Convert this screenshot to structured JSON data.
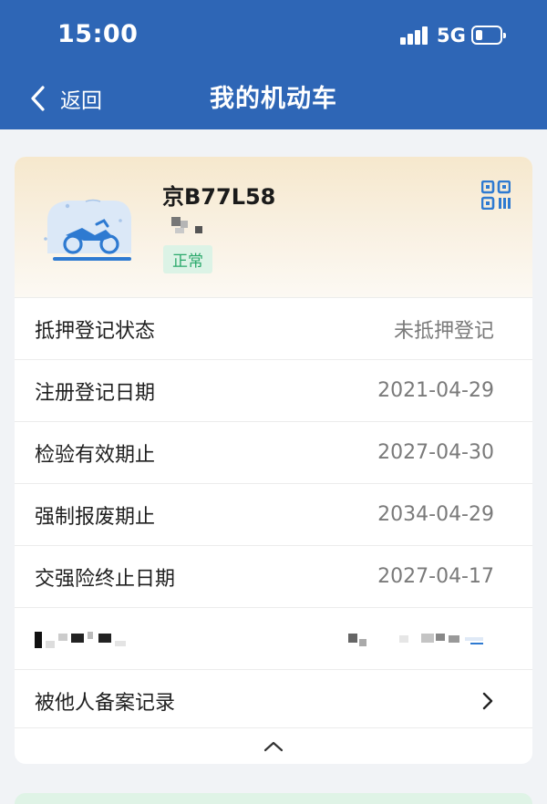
{
  "status_bar": {
    "time": "15:00",
    "network": "5G"
  },
  "nav": {
    "back_label": "返回",
    "title": "我的机动车"
  },
  "vehicle": {
    "plate": "京B77L58",
    "status": "正常"
  },
  "rows": [
    {
      "label": "抵押登记状态",
      "value": "未抵押登记"
    },
    {
      "label": "注册登记日期",
      "value": "2021-04-29"
    },
    {
      "label": "检验有效期止",
      "value": "2027-04-30"
    },
    {
      "label": "强制报废期止",
      "value": "2034-04-29"
    },
    {
      "label": "交强险终止日期",
      "value": "2027-04-17"
    }
  ],
  "record_link": {
    "label": "被他人备案记录"
  },
  "colors": {
    "header": "#2e66b6",
    "status_ok_text": "#29a86a",
    "status_ok_bg": "#dcf3e6",
    "accent": "#2e7ad1"
  },
  "icons": [
    "back-chevron-icon",
    "motorcycle-icon",
    "qr-code-icon",
    "chevron-right-icon",
    "chevron-up-icon",
    "signal-icon",
    "battery-icon"
  ]
}
